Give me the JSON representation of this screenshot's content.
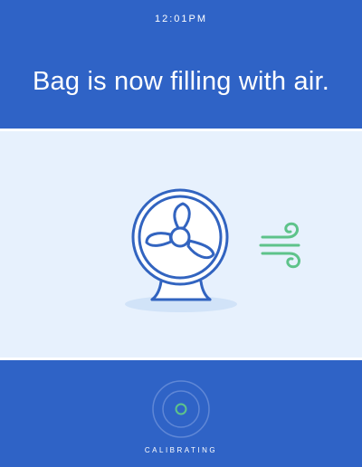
{
  "status_bar": {
    "time": "12:01PM"
  },
  "header": {
    "message": "Bag is now filling with air."
  },
  "illustration": {
    "icons": [
      "fan-icon",
      "wind-icon"
    ],
    "colors": {
      "fan_stroke": "#3264c0",
      "fan_fill": "#ffffff",
      "wind": "#5ec38a",
      "shadow": "#d1e3f8"
    }
  },
  "footer": {
    "status_label": "CALIBRATING",
    "indicator_icon": "calibrating-ring-icon",
    "indicator_color": "#5ec38a"
  },
  "colors": {
    "primary": "#2f63c6",
    "panel": "#e7f1fd",
    "text_on_primary": "#ffffff"
  }
}
